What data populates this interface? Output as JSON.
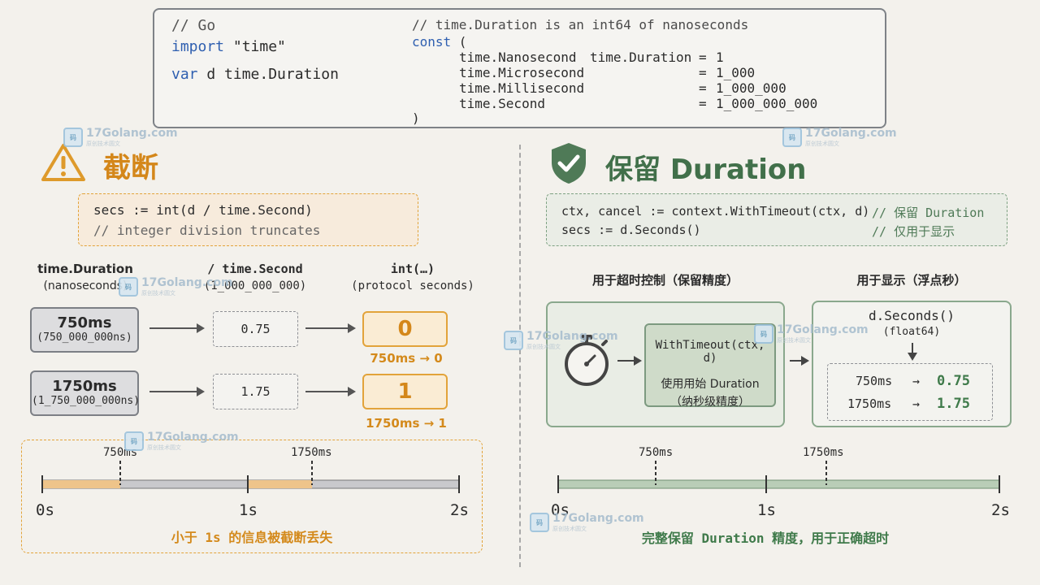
{
  "code": {
    "left": [
      "// Go",
      "import \"time\"",
      "var d time.Duration"
    ],
    "right_comment": "// time.Duration is an int64 of nanoseconds",
    "const_open": "const (",
    "consts": [
      {
        "name": "time.Nanosecond",
        "type": "time.Duration",
        "eq": "=",
        "value": "1"
      },
      {
        "name": "time.Microsecond",
        "type": "",
        "eq": "=",
        "value": "1_000"
      },
      {
        "name": "time.Millisecond",
        "type": "",
        "eq": "=",
        "value": "1_000_000"
      },
      {
        "name": "time.Second",
        "type": "",
        "eq": "=",
        "value": "1_000_000_000"
      }
    ],
    "const_close": ")"
  },
  "watermark": {
    "text": "17Golang.com",
    "sub": "原创技术圆文",
    "logo": "码"
  },
  "left": {
    "title": "截断",
    "icon": "warning-icon",
    "snippet": [
      "secs := int(d / time.Second)",
      "// integer division truncates"
    ],
    "col_heads": [
      {
        "title": "time.Duration",
        "sub": "(nanoseconds)"
      },
      {
        "title": "/ time.Second",
        "sub": "(1_000_000_000)"
      },
      {
        "title": "int(…)",
        "sub": "(protocol seconds)"
      }
    ],
    "rows": [
      {
        "ms": "750ms",
        "ns": "(750_000_000ns)",
        "div": "0.75",
        "result": "0",
        "note": "750ms → 0"
      },
      {
        "ms": "1750ms",
        "ns": "(1_750_000_000ns)",
        "div": "1.75",
        "result": "1",
        "note": "1750ms → 1"
      }
    ],
    "timeline": {
      "marks": [
        "750ms",
        "1750ms"
      ],
      "ticks": [
        "0s",
        "1s",
        "2s"
      ],
      "caption": "小于 1s 的信息被截断丢失"
    }
  },
  "right": {
    "title": "保留 Duration",
    "icon": "shield-check-icon",
    "snippet": [
      {
        "code": "ctx, cancel := context.WithTimeout(ctx, d)",
        "comment": "// 保留 Duration"
      },
      {
        "code": "secs := d.Seconds()",
        "comment": "// 仅用于显示"
      }
    ],
    "timeout_head": "用于超时控制（保留精度）",
    "display_head": "用于显示（浮点秒）",
    "timeout_icon": "stopwatch-icon",
    "timeout_box": [
      "WithTimeout(ctx, d)",
      "使用用始 Duration",
      "（纳秒级精度）"
    ],
    "seconds_func": "d.Seconds()",
    "seconds_type": "(float64)",
    "conversions": [
      {
        "from": "750ms",
        "arrow": "→",
        "to": "0.75"
      },
      {
        "from": "1750ms",
        "arrow": "→",
        "to": "1.75"
      }
    ],
    "timeline": {
      "marks": [
        "750ms",
        "1750ms"
      ],
      "ticks": [
        "0s",
        "1s",
        "2s"
      ],
      "caption": "完整保留 Duration 精度，用于正确超时"
    }
  },
  "colors": {
    "orange": "#d48a1c",
    "green": "#3f7a4a",
    "blue_keyword": "#2f5fb0"
  }
}
